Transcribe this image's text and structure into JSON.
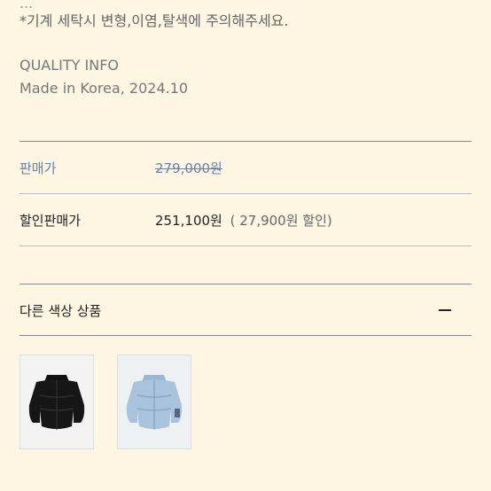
{
  "notice": {
    "cut_line": "...",
    "wash_warning": "*기계 세탁시 변형,이염,탈색에 주의해주세요."
  },
  "quality": {
    "title": "QUALITY INFO",
    "made_in": "Made in Korea, 2024.10"
  },
  "price": {
    "label": "판매가",
    "original": "279,000원"
  },
  "sale": {
    "label": "할인판매가",
    "price": "251,100원",
    "discount": "( 27,900원 할인)"
  },
  "other_colors": {
    "title": "다른 색상 상품",
    "toggle_icon": "minus-icon",
    "items": [
      {
        "color_name": "black",
        "swatch": "#1a1a1a"
      },
      {
        "color_name": "light-blue",
        "swatch": "#a9c3dc"
      }
    ]
  },
  "colors": {
    "background": "#fdf6e3",
    "price_accent": "#6b7fa8",
    "divider": "#bdbdbd"
  }
}
